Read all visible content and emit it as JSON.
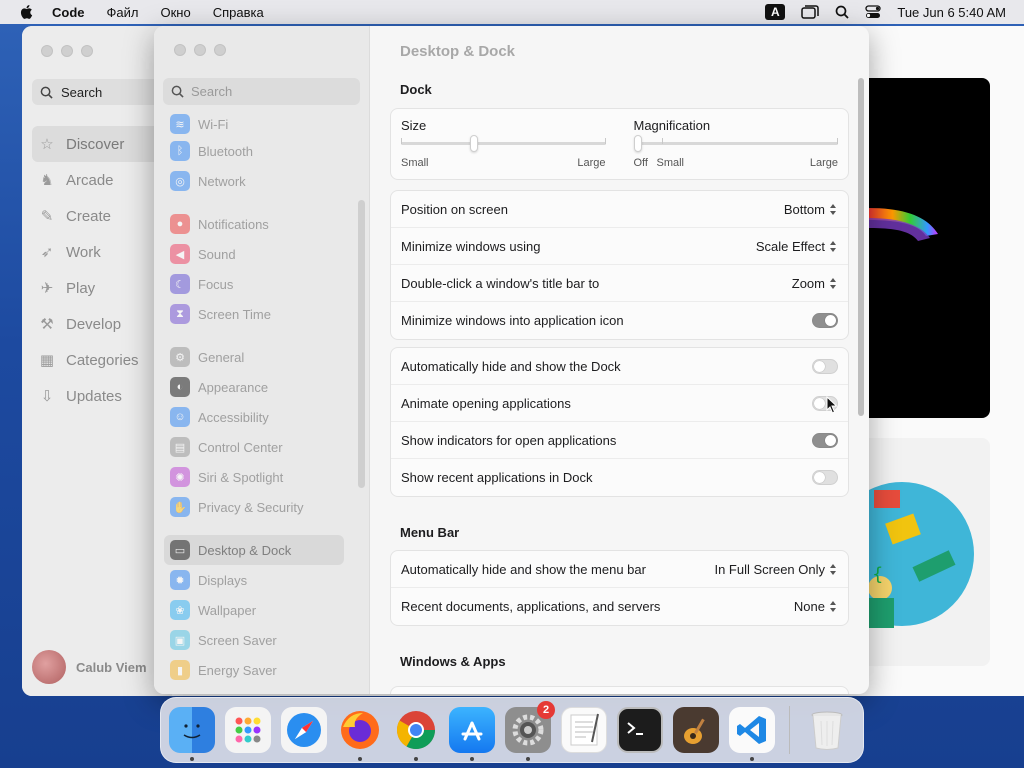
{
  "menubar": {
    "app_name": "Code",
    "menus": [
      "Файл",
      "Окно",
      "Справка"
    ],
    "input_indicator": "A",
    "datetime": "Tue Jun 6  5:40 AM"
  },
  "appstore": {
    "search_label": "Search",
    "nav": [
      {
        "label": "Discover",
        "icon": "star-icon"
      },
      {
        "label": "Arcade",
        "icon": "joystick-icon"
      },
      {
        "label": "Create",
        "icon": "brush-icon"
      },
      {
        "label": "Work",
        "icon": "paperplane-icon"
      },
      {
        "label": "Play",
        "icon": "rocket-icon"
      },
      {
        "label": "Develop",
        "icon": "hammer-icon"
      },
      {
        "label": "Categories",
        "icon": "grid-icon"
      },
      {
        "label": "Updates",
        "icon": "download-icon"
      }
    ],
    "user_name": "Calub Viem"
  },
  "settings": {
    "search_placeholder": "Search",
    "sidebar": [
      {
        "label": "Wi-Fi",
        "color": "#3b8df5"
      },
      {
        "label": "Bluetooth",
        "color": "#3b8df5"
      },
      {
        "label": "Network",
        "color": "#3b8df5"
      },
      {
        "label": "Notifications",
        "color": "#ef4b4b"
      },
      {
        "label": "Sound",
        "color": "#ef4b6b"
      },
      {
        "label": "Focus",
        "color": "#6b5bd6"
      },
      {
        "label": "Screen Time",
        "color": "#7b5bd6"
      },
      {
        "label": "General",
        "color": "#9a9a9a"
      },
      {
        "label": "Appearance",
        "color": "#222222"
      },
      {
        "label": "Accessibility",
        "color": "#3b8df5"
      },
      {
        "label": "Control Center",
        "color": "#9a9a9a"
      },
      {
        "label": "Siri & Spotlight",
        "color": "#c04fd6"
      },
      {
        "label": "Privacy & Security",
        "color": "#3b8df5"
      },
      {
        "label": "Desktop & Dock",
        "color": "#222222"
      },
      {
        "label": "Displays",
        "color": "#3b8df5"
      },
      {
        "label": "Wallpaper",
        "color": "#3bb6f5"
      },
      {
        "label": "Screen Saver",
        "color": "#5bc6e6"
      },
      {
        "label": "Energy Saver",
        "color": "#f5b83b"
      }
    ],
    "title": "Desktop & Dock",
    "dock": {
      "section": "Dock",
      "size_label": "Size",
      "size_small": "Small",
      "size_large": "Large",
      "size_value": 0.35,
      "mag_label": "Magnification",
      "mag_off": "Off",
      "mag_small": "Small",
      "mag_large": "Large",
      "mag_value": 0.0,
      "rows": [
        {
          "label": "Position on screen",
          "value": "Bottom"
        },
        {
          "label": "Minimize windows using",
          "value": "Scale Effect"
        },
        {
          "label": "Double-click a window's title bar to",
          "value": "Zoom"
        }
      ],
      "toggle_minimize_into_icon": "Minimize windows into application icon",
      "toggles": [
        {
          "label": "Automatically hide and show the Dock",
          "on": false
        },
        {
          "label": "Animate opening applications",
          "on": false
        },
        {
          "label": "Show indicators for open applications",
          "on": true
        },
        {
          "label": "Show recent applications in Dock",
          "on": false
        }
      ]
    },
    "menubar_section": {
      "section": "Menu Bar",
      "rows": [
        {
          "label": "Automatically hide and show the menu bar",
          "value": "In Full Screen Only"
        },
        {
          "label": "Recent documents, applications, and servers",
          "value": "None"
        }
      ]
    },
    "windows_section": "Windows & Apps"
  },
  "dock_apps": [
    "Finder",
    "Launchpad",
    "Safari",
    "Firefox",
    "Chrome",
    "App Store",
    "System Settings",
    "TextEdit",
    "Terminal",
    "Instruments",
    "Visual Studio Code",
    "Trash"
  ],
  "dock_badge": "2"
}
